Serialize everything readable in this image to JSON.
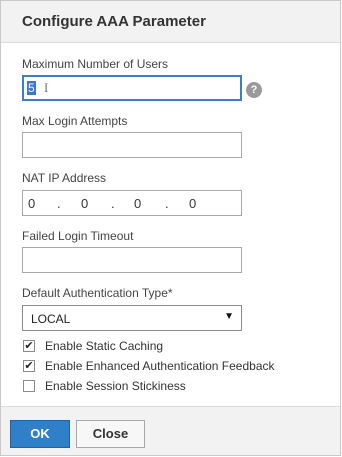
{
  "dialog": {
    "title": "Configure AAA Parameter"
  },
  "fields": {
    "max_users": {
      "label": "Maximum Number of Users",
      "value": "5"
    },
    "max_login_attempts": {
      "label": "Max Login Attempts",
      "value": ""
    },
    "nat_ip": {
      "label": "NAT IP Address",
      "octets": [
        "0",
        "0",
        "0",
        "0"
      ]
    },
    "failed_login_timeout": {
      "label": "Failed Login Timeout",
      "value": ""
    },
    "default_auth_type": {
      "label": "Default Authentication Type*",
      "selected": "LOCAL"
    }
  },
  "icons": {
    "help": "?"
  },
  "checkboxes": [
    {
      "label": "Enable Static Caching",
      "checked": true
    },
    {
      "label": "Enable Enhanced Authentication Feedback",
      "checked": true
    },
    {
      "label": "Enable Session Stickiness",
      "checked": false
    }
  ],
  "footer": {
    "ok_label": "OK",
    "close_label": "Close"
  },
  "colors": {
    "primary_button": "#2f80c8",
    "focus_border": "#3c7fc7",
    "header_bg": "#f2f2f2"
  }
}
